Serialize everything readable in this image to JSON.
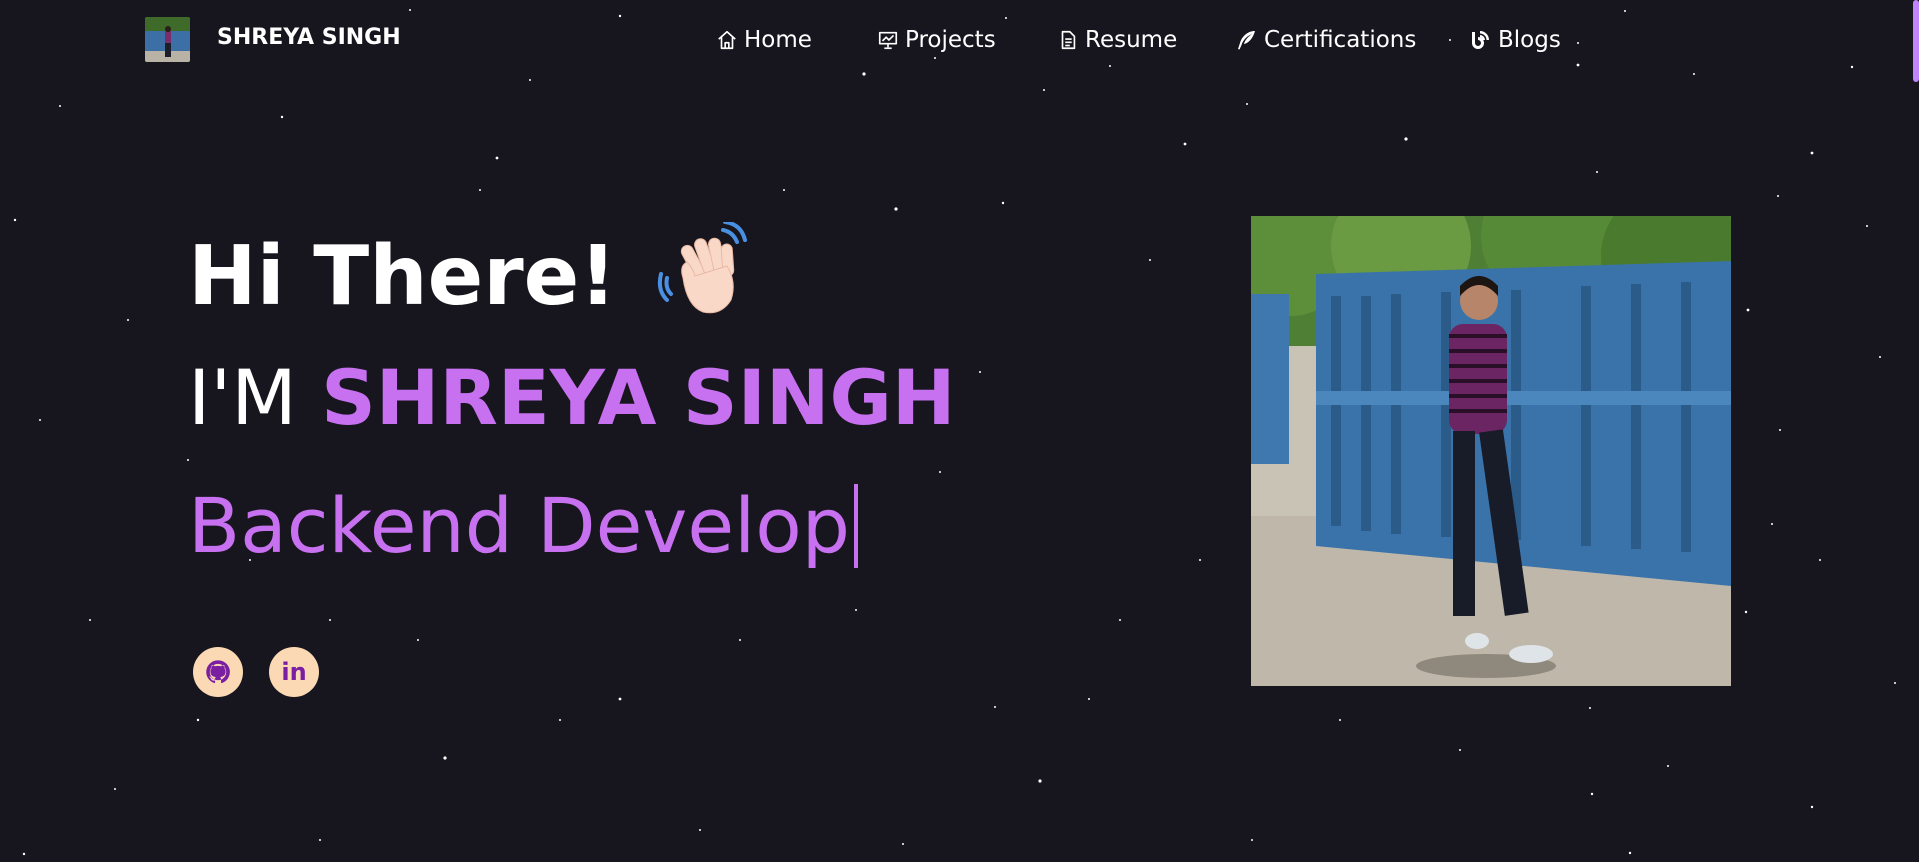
{
  "brand": {
    "name": "SHREYA SINGH",
    "avatar_icon": "profile-photo-thumbnail"
  },
  "nav": {
    "items": [
      {
        "label": "Home",
        "icon": "home-icon"
      },
      {
        "label": "Projects",
        "icon": "presentation-chart-icon"
      },
      {
        "label": "Resume",
        "icon": "document-icon"
      },
      {
        "label": "Certifications",
        "icon": "quill-pen-icon"
      },
      {
        "label": "Blogs",
        "icon": "blog-icon"
      }
    ]
  },
  "hero": {
    "greeting": "Hi There!",
    "wave_icon": "waving-hand-emoji",
    "intro_prefix": "I'M",
    "intro_name": "SHREYA SINGH",
    "typed_role": "Backend Develop"
  },
  "social": {
    "links": [
      {
        "icon": "github-icon"
      },
      {
        "icon": "linkedin-icon",
        "label": "in"
      }
    ]
  },
  "colors": {
    "background": "#17161e",
    "accent_purple": "#c770f0",
    "social_bg": "#fbd9b4",
    "social_icon": "#7b1fa2"
  },
  "photo": {
    "subject": "person-standing-near-blue-gate-photo"
  }
}
